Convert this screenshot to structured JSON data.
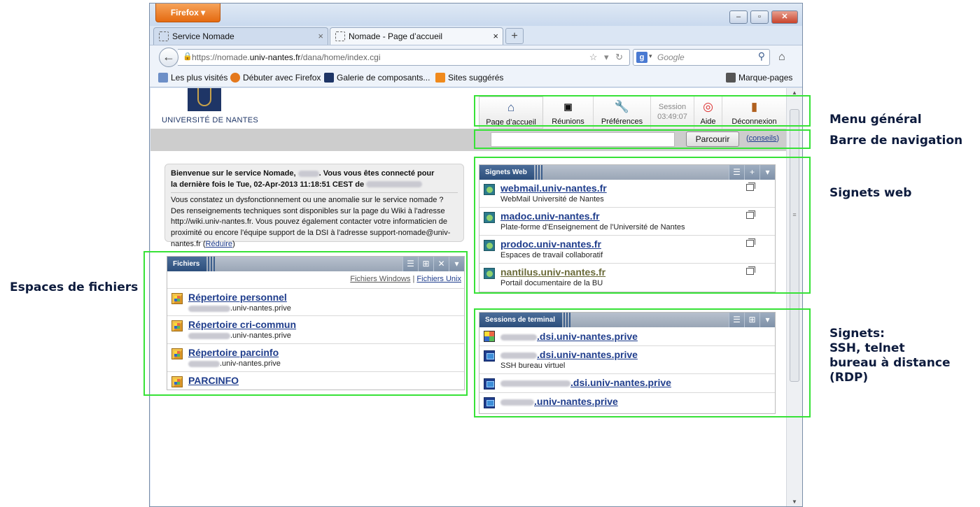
{
  "browser": {
    "menu_button": "Firefox",
    "tabs": [
      {
        "label": "Service Nomade"
      },
      {
        "label": "Nomade - Page d’accueil"
      }
    ],
    "url_prefix": "https://nomade.",
    "url_host": "univ-nantes.fr",
    "url_path": "/dana/home/index.cgi",
    "search_placeholder": "Google",
    "bookmarks": [
      "Les plus visités",
      "Débuter avec Firefox",
      "Galerie de composants...",
      "Sites suggérés"
    ],
    "bookmarks_menu": "Marque-pages"
  },
  "page": {
    "university": "UNIVERSITÉ DE NANTES",
    "menu": {
      "home": "Page d’accueil",
      "meetings": "Réunions",
      "prefs": "Préférences",
      "session_label": "Session",
      "session_time": "03:49:07",
      "help": "Aide",
      "logout": "Déconnexion"
    },
    "nav": {
      "browse_button": "Parcourir",
      "tips": "conseils"
    },
    "welcome": {
      "line1": "Bienvenue sur le service Nomade,",
      "line1b": ". Vous vous êtes connecté pour",
      "line2": "la dernière fois le Tue, 02-Apr-2013 11:18:51 CEST de",
      "body": "Vous constatez un dysfonctionnement ou une anomalie sur le service nomade ? Des renseignements techniques sont disponibles sur la page du Wiki à l'adresse http://wiki.univ-nantes.fr. Vous pouvez également contacter votre informaticien de proximité ou encore l'équipe support de la DSI à l'adresse support-nomade@univ-nantes.fr (",
      "reduce": "Réduire",
      "close_paren": ")"
    },
    "files": {
      "title": "Fichiers",
      "link_windows": "Fichiers Windows",
      "link_unix": "Fichiers Unix",
      "sep": "|",
      "items": [
        {
          "name": "Répertoire personnel",
          "host": ".univ-nantes.prive"
        },
        {
          "name": "Répertoire cri-commun",
          "host": ".univ-nantes.prive"
        },
        {
          "name": "Répertoire parcinfo",
          "host": ".univ-nantes.prive"
        },
        {
          "name": "PARCINFO",
          "host": ""
        }
      ]
    },
    "web_bookmarks": {
      "title": "Signets Web",
      "items": [
        {
          "name": "webmail.univ-nantes.fr",
          "desc": "WebMail Université de Nantes"
        },
        {
          "name": "madoc.univ-nantes.fr",
          "desc": "Plate-forme d'Enseignement de l'Université de Nantes"
        },
        {
          "name": "prodoc.univ-nantes.fr",
          "desc": "Espaces de travail collaboratif"
        },
        {
          "name": "nantilus.univ-nantes.fr",
          "desc": "Portail documentaire de la BU"
        }
      ]
    },
    "terminal": {
      "title": "Sessions de terminal",
      "items": [
        {
          "name": ".dsi.univ-nantes.prive",
          "desc": ""
        },
        {
          "name": ".dsi.univ-nantes.prive",
          "desc": "SSH bureau virtuel"
        },
        {
          "name": ".dsi.univ-nantes.prive",
          "desc": ""
        },
        {
          "name": ".univ-nantes.prive",
          "desc": ""
        }
      ]
    }
  },
  "annotations": {
    "menu": "Menu général",
    "navbar": "Barre de navigation",
    "web": "Signets web",
    "files": "Espaces de fichiers",
    "terminal_1": "Signets:",
    "terminal_2": "SSH, telnet",
    "terminal_3": "bureau à distance (RDP)"
  },
  "colors": {
    "annotation_box": "#37e237",
    "firefox_button": "#e56a10",
    "link": "#1f3d8c"
  }
}
